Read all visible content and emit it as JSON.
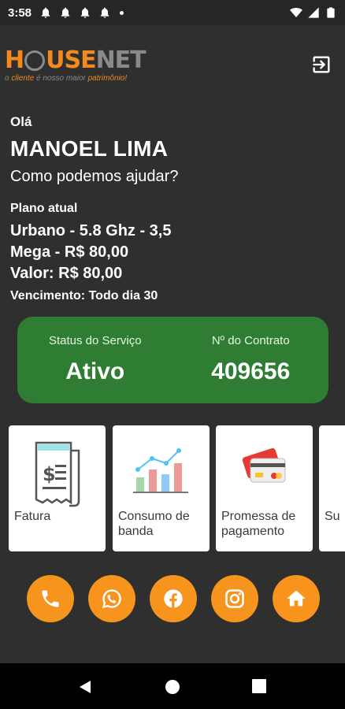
{
  "status_bar": {
    "time": "3:58"
  },
  "logo": {
    "part1": "H",
    "part2": "USE",
    "part3": "NET",
    "tagline_pre": "o ",
    "tagline_hl1": "cliente",
    "tagline_mid": " é nosso maior ",
    "tagline_hl2": "patrimônio!"
  },
  "greeting": {
    "hello": "Olá",
    "name": "MANOEL LIMA",
    "help": "Como podemos ajudar?"
  },
  "plan": {
    "label": "Plano atual",
    "line1": "Urbano - 5.8 Ghz - 3,5",
    "line2": "Mega - R$ 80,00",
    "line3": "Valor: R$ 80,00",
    "due": "Vencimento: Todo dia 30"
  },
  "service": {
    "status_label": "Status do Serviço",
    "status_value": "Ativo",
    "contract_label": "Nº do Contrato",
    "contract_value": "409656"
  },
  "tiles": [
    {
      "label": "Fatura"
    },
    {
      "label": "Consumo de banda"
    },
    {
      "label": "Promessa de pagamento"
    },
    {
      "label": "Su"
    }
  ],
  "colors": {
    "background": "#2f2f2f",
    "accent": "#f7941d",
    "status_card": "#2e7d32",
    "brand_orange": "#f28a1e"
  },
  "icons": [
    "phone-icon",
    "whatsapp-icon",
    "facebook-icon",
    "instagram-icon",
    "home-icon"
  ]
}
